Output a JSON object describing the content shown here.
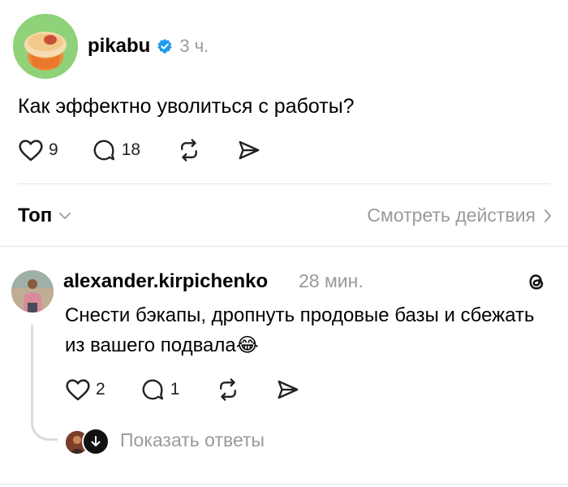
{
  "post": {
    "author": "pikabu",
    "verified_icon": "verified-badge-icon",
    "time": "3 ч.",
    "text": "Как эффектно уволиться с работы?",
    "likes": "9",
    "comments": "18",
    "accent": "#1d9bf0"
  },
  "sort": {
    "label": "Топ",
    "view_activity": "Смотреть действия"
  },
  "comment": {
    "author": "alexander.kirpichenko",
    "time": "28 мин.",
    "text": "Снести бэкапы, дропнуть продовые базы и сбежать из вашего подвала😂",
    "likes": "2",
    "comments": "1",
    "show_replies": "Показать ответы"
  }
}
